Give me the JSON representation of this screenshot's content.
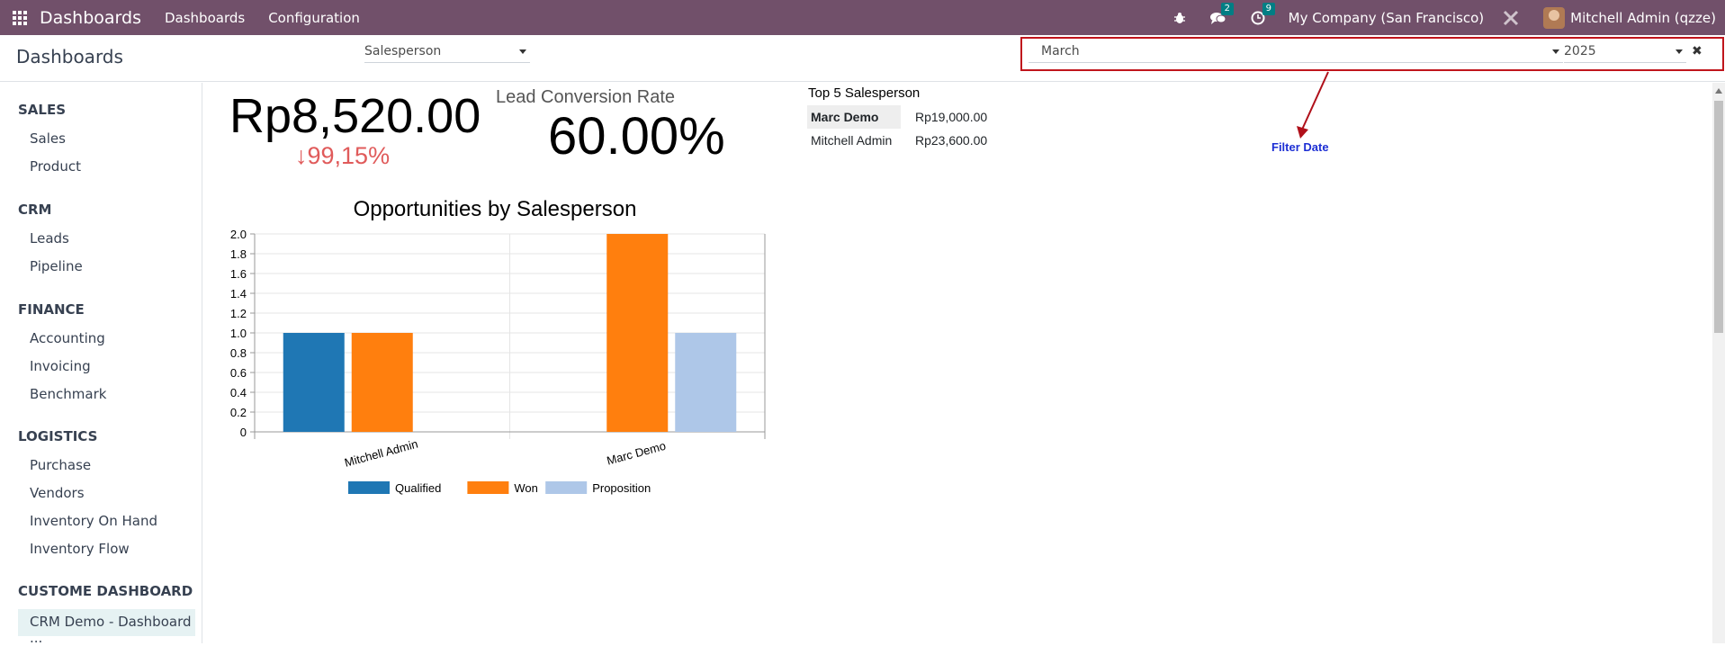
{
  "topbar": {
    "brand": "Dashboards",
    "menus": [
      "Dashboards",
      "Configuration"
    ],
    "messages_count": "2",
    "activities_count": "9",
    "company": "My Company (San Francisco)",
    "user": "Mitchell Admin (qzze)"
  },
  "control": {
    "title": "Dashboards",
    "group_select": "Salesperson",
    "month_select": "March",
    "year_select": "2025"
  },
  "sidebar": {
    "sections": [
      {
        "title": "SALES",
        "items": [
          "Sales",
          "Product"
        ]
      },
      {
        "title": "CRM",
        "items": [
          "Leads",
          "Pipeline"
        ]
      },
      {
        "title": "FINANCE",
        "items": [
          "Accounting",
          "Invoicing",
          "Benchmark"
        ]
      },
      {
        "title": "LOGISTICS",
        "items": [
          "Purchase",
          "Vendors",
          "Inventory On Hand",
          "Inventory Flow"
        ]
      },
      {
        "title": "CUSTOME DASHBOARD",
        "items": [
          "CRM Demo - Dashboard ..."
        ]
      }
    ]
  },
  "kpi": {
    "revenue": "Rp8,520.00",
    "delta": "99,15%",
    "conversion_label": "Lead Conversion Rate",
    "conversion_value": "60.00%"
  },
  "top5": {
    "title": "Top 5 Salesperson",
    "rows": [
      {
        "name": "Marc Demo",
        "amount": "Rp19,000.00"
      },
      {
        "name": "Mitchell Admin",
        "amount": "Rp23,600.00"
      }
    ]
  },
  "annotation": "Filter Date",
  "chart_data": {
    "type": "bar",
    "title": "Opportunities by Salesperson",
    "categories": [
      "Mitchell Admin",
      "Marc Demo"
    ],
    "series": [
      {
        "name": "Qualified",
        "color": "#1f77b4",
        "values": [
          1,
          0
        ]
      },
      {
        "name": "Won",
        "color": "#ff7f0e",
        "values": [
          1,
          2
        ]
      },
      {
        "name": "Proposition",
        "color": "#aec7e8",
        "values": [
          0,
          1
        ]
      }
    ],
    "ylim": [
      0,
      2
    ],
    "yticks": [
      "0",
      "0.2",
      "0.4",
      "0.6",
      "0.8",
      "1.0",
      "1.2",
      "1.4",
      "1.6",
      "1.8",
      "2.0"
    ],
    "grid": true,
    "legend": "bottom"
  }
}
